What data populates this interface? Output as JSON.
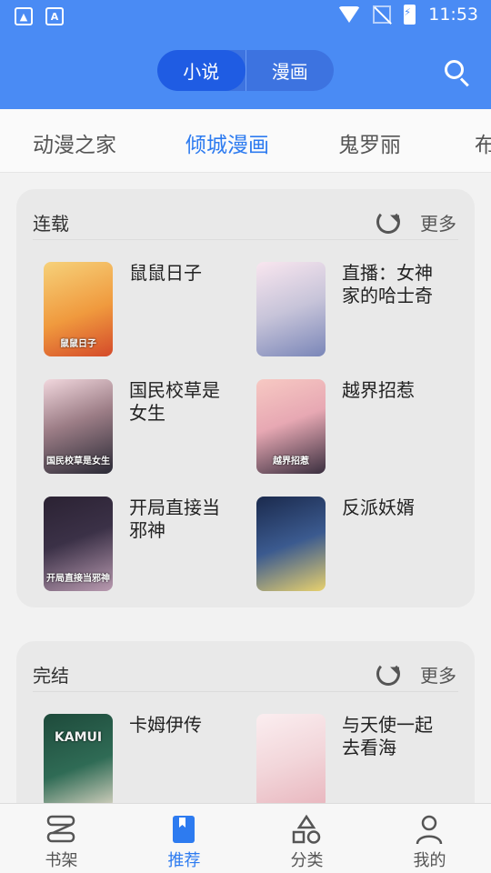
{
  "status_bar": {
    "time": "11:53",
    "left_icons": [
      "image-icon",
      "a-icon"
    ],
    "right_icons": [
      "wifi-icon",
      "no-signal-icon",
      "battery-charging-icon"
    ]
  },
  "header": {
    "segments": [
      {
        "label": "小说",
        "active": true
      },
      {
        "label": "漫画",
        "active": false
      }
    ],
    "search_icon": "search-icon"
  },
  "source_tabs": [
    {
      "label": "动漫之家",
      "active": false
    },
    {
      "label": "倾城漫画",
      "active": true
    },
    {
      "label": "鬼罗丽",
      "active": false
    },
    {
      "label": "布",
      "active": false
    }
  ],
  "sections": [
    {
      "title": "连载",
      "more_label": "更多",
      "refresh_icon": "refresh-icon",
      "items": [
        {
          "title": "鼠鼠日子",
          "cover_text": "鼠鼠日子"
        },
        {
          "title": "直播：女神家的哈士奇",
          "cover_text": ""
        },
        {
          "title": "国民校草是女生",
          "cover_text": "国民校草是女生"
        },
        {
          "title": "越界招惹",
          "cover_text": "越界招惹"
        },
        {
          "title": "开局直接当邪神",
          "cover_text": "开局直接当邪神"
        },
        {
          "title": "反派妖婿",
          "cover_text": ""
        }
      ]
    },
    {
      "title": "完结",
      "more_label": "更多",
      "refresh_icon": "refresh-icon",
      "items": [
        {
          "title": "卡姆伊传",
          "cover_text": "KAMUI"
        },
        {
          "title": "与天使一起去看海",
          "cover_text": ""
        }
      ]
    }
  ],
  "bottom_nav": [
    {
      "label": "书架",
      "icon": "bookshelf-icon",
      "active": false
    },
    {
      "label": "推荐",
      "icon": "bookmark-icon",
      "active": true
    },
    {
      "label": "分类",
      "icon": "category-icon",
      "active": false
    },
    {
      "label": "我的",
      "icon": "person-icon",
      "active": false
    }
  ],
  "colors": {
    "primary": "#4a8bf4",
    "accent": "#2d7bf0",
    "segment_active": "#1f5ce3"
  }
}
